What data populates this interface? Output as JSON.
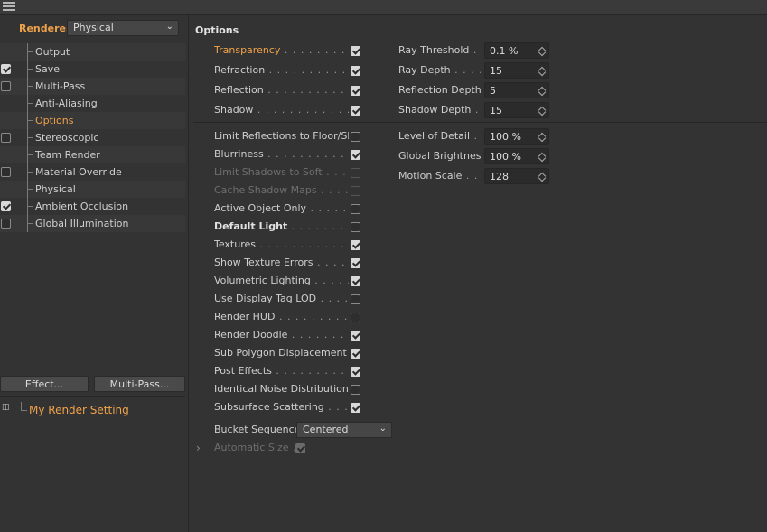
{
  "renderer": {
    "label": "Renderer",
    "value": "Physical"
  },
  "tree": [
    {
      "label": "Output",
      "checkbox": false,
      "checked": false,
      "active": false
    },
    {
      "label": "Save",
      "checkbox": true,
      "checked": true,
      "active": false
    },
    {
      "label": "Multi-Pass",
      "checkbox": true,
      "checked": false,
      "active": false
    },
    {
      "label": "Anti-Aliasing",
      "checkbox": false,
      "checked": false,
      "active": false
    },
    {
      "label": "Options",
      "checkbox": false,
      "checked": false,
      "active": true
    },
    {
      "label": "Stereoscopic",
      "checkbox": true,
      "checked": false,
      "active": false
    },
    {
      "label": "Team Render",
      "checkbox": false,
      "checked": false,
      "active": false
    },
    {
      "label": "Material Override",
      "checkbox": true,
      "checked": false,
      "active": false
    },
    {
      "label": "Physical",
      "checkbox": false,
      "checked": false,
      "active": false
    },
    {
      "label": "Ambient Occlusion",
      "checkbox": true,
      "checked": true,
      "active": false
    },
    {
      "label": "Global Illumination",
      "checkbox": true,
      "checked": false,
      "active": false
    }
  ],
  "buttons": {
    "effect": "Effect...",
    "multipass": "Multi-Pass..."
  },
  "render_setting": "My Render Setting",
  "options": {
    "title": "Options",
    "left_top": [
      {
        "name": "Transparency",
        "dots": ". . . . . . . . . . . .",
        "checked": true,
        "active": true
      },
      {
        "name": "Refraction",
        "dots": ". . . . . . . . . . . . . . .",
        "checked": true
      },
      {
        "name": "Reflection",
        "dots": ". . . . . . . . . . . . . . .",
        "checked": true
      },
      {
        "name": "Shadow",
        "dots": ". . . . . . . . . . . . . . . .",
        "checked": true
      }
    ],
    "right_top": [
      {
        "name": "Ray Threshold",
        "dots": ". .",
        "value": "0.1 %"
      },
      {
        "name": "Ray Depth",
        "dots": ". . . .",
        "value": "15"
      },
      {
        "name": "Reflection Depth",
        "dots": "",
        "value": "5"
      },
      {
        "name": "Shadow Depth",
        "dots": ". .",
        "value": "15"
      }
    ],
    "left_bottom": [
      {
        "name": "Limit Reflections to Floor/Sky",
        "dots": "",
        "checked": false
      },
      {
        "name": "Blurriness",
        "dots": ". . . . . . . . . . . . . .",
        "checked": true
      },
      {
        "name": "Limit Shadows to Soft",
        "dots": ". . . . .",
        "checked": false,
        "disabled": true
      },
      {
        "name": "Cache Shadow Maps",
        "dots": ". . . . . .",
        "checked": false,
        "disabled": true
      },
      {
        "name": "Active Object Only",
        "dots": ". . . . . . . .",
        "checked": false
      },
      {
        "name": "Default Light",
        "dots": ". . . . . . . . . . .",
        "checked": false,
        "bold": true
      },
      {
        "name": "Textures",
        "dots": ". . . . . . . . . . . . . . . .",
        "checked": true
      },
      {
        "name": "Show Texture Errors",
        "dots": ". . . . . . .",
        "checked": true
      },
      {
        "name": "Volumetric Lighting",
        "dots": ". . . . . . .",
        "checked": true
      },
      {
        "name": "Use Display Tag LOD",
        "dots": ". . . . . .",
        "checked": false
      },
      {
        "name": "Render HUD",
        "dots": ". . . . . . . . . . . . .",
        "checked": false
      },
      {
        "name": "Render Doodle",
        "dots": ". . . . . . . . . . .",
        "checked": true
      },
      {
        "name": "Sub Polygon Displacement",
        "dots": ". .",
        "checked": true
      },
      {
        "name": "Post Effects",
        "dots": ". . . . . . . . . . . . .",
        "checked": true
      },
      {
        "name": "Identical Noise Distribution",
        "dots": "",
        "checked": false
      },
      {
        "name": "Subsurface Scattering",
        "dots": ". . . . .",
        "checked": true
      }
    ],
    "right_bottom": [
      {
        "name": "Level of Detail",
        "dots": ". .",
        "value": "100 %"
      },
      {
        "name": "Global Brightness",
        "dots": "",
        "value": "100 %"
      },
      {
        "name": "Motion Scale",
        "dots": ". . .",
        "value": "128"
      }
    ],
    "bucket": {
      "name": "Bucket Sequence",
      "value": "Centered"
    },
    "auto_size": {
      "name": "Automatic Size",
      "dots": ".",
      "checked": true
    }
  }
}
